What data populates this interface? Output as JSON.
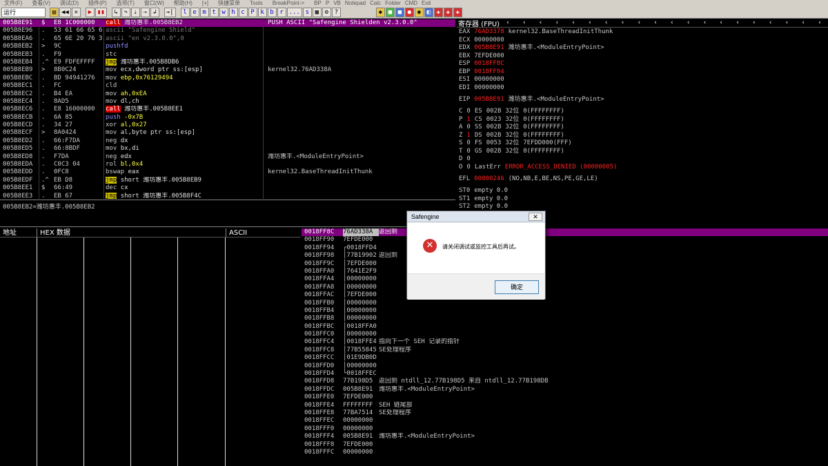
{
  "menu": {
    "items": [
      "文件(F)",
      "查看(V)",
      "调试(D)",
      "插件(P)",
      "选项(T)",
      "窗口(W)",
      "帮助(H)",
      "[+]",
      "快捷菜单",
      "Tools",
      "BreakPoint->"
    ],
    "extra": [
      "BP",
      "P",
      "VB",
      "Notepad",
      "Calc",
      "Folder",
      "CMD",
      "Exit"
    ]
  },
  "toolbar": {
    "status": "运行",
    "letters": [
      "l",
      "e",
      "m",
      "t",
      "w",
      "h",
      "c",
      "P",
      "k",
      "b",
      "r",
      "...",
      "s"
    ]
  },
  "cpu": {
    "rows": [
      {
        "addr": "005B8E91",
        "mark": "$",
        "hex": "E8 1C000000",
        "mn": "call",
        "op": "潍坊惠丰.005B8EB2",
        "cmt": "PUSH ASCII \"Safengine Shielden v2.3.0.0\"",
        "sel": true
      },
      {
        "addr": "005B8E96",
        "mark": ".",
        "hex": "53 61 66 65 6",
        "mn": "ascii",
        "op": "\"Safengine Shield\"",
        "cmt": ""
      },
      {
        "addr": "005B8EA6",
        "mark": ".",
        "hex": "65 6E 20 76 3",
        "mn": "ascii",
        "op": "\"en v2.3.0.0\",0",
        "cmt": ""
      },
      {
        "addr": "005B8EB2",
        "mark": ">",
        "hex": "9C",
        "mn": "pushfd",
        "op": "",
        "cmt": ""
      },
      {
        "addr": "005B8EB3",
        "mark": ".",
        "hex": "F9",
        "mn": "stc",
        "op": "",
        "cmt": ""
      },
      {
        "addr": "005B8EB4",
        "mark": ".^",
        "hex": "E9 FDFEFFFF",
        "mn": "jmp",
        "op": "潍坊惠丰.005B8DB6",
        "cmt": ""
      },
      {
        "addr": "005B8EB9",
        "mark": ">",
        "hex": "8B0C24",
        "mn": "mov",
        "op": "ecx,dword ptr ss:[esp]",
        "cmt": "kernel32.76AD338A"
      },
      {
        "addr": "005B8EBC",
        "mark": ".",
        "hex": "BD 94941276",
        "mn": "mov",
        "op": "ebp,0x76129494",
        "cmt": ""
      },
      {
        "addr": "005B8EC1",
        "mark": ".",
        "hex": "FC",
        "mn": "cld",
        "op": "",
        "cmt": ""
      },
      {
        "addr": "005B8EC2",
        "mark": ".",
        "hex": "B4 EA",
        "mn": "mov",
        "op": "ah,0xEA",
        "cmt": ""
      },
      {
        "addr": "005B8EC4",
        "mark": ".",
        "hex": "8AD5",
        "mn": "mov",
        "op": "dl,ch",
        "cmt": ""
      },
      {
        "addr": "005B8EC6",
        "mark": ".",
        "hex": "E8 16000000",
        "mn": "call",
        "op": "潍坊惠丰.005B8EE1",
        "cmt": ""
      },
      {
        "addr": "005B8ECB",
        "mark": ".",
        "hex": "6A 85",
        "mn": "push",
        "op": "-0x7B",
        "cmt": ""
      },
      {
        "addr": "005B8ECD",
        "mark": ".",
        "hex": "34 27",
        "mn": "xor",
        "op": "al,0x27",
        "cmt": ""
      },
      {
        "addr": "005B8ECF",
        "mark": ">",
        "hex": "8A0424",
        "mn": "mov",
        "op": "al,byte ptr ss:[esp]",
        "cmt": ""
      },
      {
        "addr": "005B8ED2",
        "mark": ".",
        "hex": "66:F7DA",
        "mn": "neg",
        "op": "dx",
        "cmt": ""
      },
      {
        "addr": "005B8ED5",
        "mark": ".",
        "hex": "66:8BDF",
        "mn": "mov",
        "op": "bx,di",
        "cmt": ""
      },
      {
        "addr": "005B8ED8",
        "mark": ".",
        "hex": "F7DA",
        "mn": "neg",
        "op": "edx",
        "cmt": "潍坊惠丰.<ModuleEntryPoint>"
      },
      {
        "addr": "005B8EDA",
        "mark": ".",
        "hex": "C0C3 04",
        "mn": "rol",
        "op": "bl,0x4",
        "cmt": ""
      },
      {
        "addr": "005B8EDD",
        "mark": ".",
        "hex": "0FC8",
        "mn": "bswap",
        "op": "eax",
        "cmt": "kernel32.BaseThreadInitThunk"
      },
      {
        "addr": "005B8EDF",
        "mark": ".^",
        "hex": "EB D8",
        "mn": "jmp",
        "op": "short 潍坊惠丰.005B8EB9",
        "cmt": ""
      },
      {
        "addr": "005B8EE1",
        "mark": "$",
        "hex": "66:49",
        "mn": "dec",
        "op": "cx",
        "cmt": ""
      },
      {
        "addr": "005B8EE3",
        "mark": ".",
        "hex": "EB 67",
        "mn": "jmp",
        "op": "short 潍坊惠丰.005B8F4C",
        "cmt": ""
      }
    ]
  },
  "info": {
    "line": "005B8EB2=潍坊惠丰.005B8EB2"
  },
  "registers": {
    "title": "寄存器 (FPU)",
    "gp": [
      {
        "name": "EAX",
        "val": "76AD3378",
        "note": "kernel32.BaseThreadInitThunk",
        "red": true
      },
      {
        "name": "ECX",
        "val": "00000000",
        "note": "",
        "red": false
      },
      {
        "name": "EDX",
        "val": "005B8E91",
        "note": "潍坊惠丰.<ModuleEntryPoint>",
        "red": true
      },
      {
        "name": "EBX",
        "val": "7EFDE000",
        "note": "",
        "red": false
      },
      {
        "name": "ESP",
        "val": "0018FF8C",
        "note": "",
        "red": true
      },
      {
        "name": "EBP",
        "val": "0018FF94",
        "note": "",
        "red": true
      },
      {
        "name": "ESI",
        "val": "00000000",
        "note": "",
        "red": false
      },
      {
        "name": "EDI",
        "val": "00000000",
        "note": "",
        "red": false
      }
    ],
    "eip": {
      "name": "EIP",
      "val": "005B8E91",
      "note": "潍坊惠丰.<ModuleEntryPoint>"
    },
    "flags": [
      {
        "f": "C",
        "v": "0",
        "red": false,
        "seg": "ES",
        "sv": "002B",
        "bits": "32位",
        "base": "0(FFFFFFFF)"
      },
      {
        "f": "P",
        "v": "1",
        "red": true,
        "seg": "CS",
        "sv": "0023",
        "bits": "32位",
        "base": "0(FFFFFFFF)"
      },
      {
        "f": "A",
        "v": "0",
        "red": false,
        "seg": "SS",
        "sv": "002B",
        "bits": "32位",
        "base": "0(FFFFFFFF)"
      },
      {
        "f": "Z",
        "v": "1",
        "red": true,
        "seg": "DS",
        "sv": "002B",
        "bits": "32位",
        "base": "0(FFFFFFFF)"
      },
      {
        "f": "S",
        "v": "0",
        "red": false,
        "seg": "FS",
        "sv": "0053",
        "bits": "32位",
        "base": "7EFDD000(FFF)"
      },
      {
        "f": "T",
        "v": "0",
        "red": false,
        "seg": "GS",
        "sv": "002B",
        "bits": "32位",
        "base": "0(FFFFFFFF)"
      },
      {
        "f": "D",
        "v": "0",
        "red": false,
        "seg": "",
        "sv": "",
        "bits": "",
        "base": ""
      }
    ],
    "lasterr": {
      "f": "O",
      "v": "0",
      "label": "LastErr",
      "val": "ERROR_ACCESS_DENIED (00000005)"
    },
    "efl": {
      "name": "EFL",
      "val": "00000246",
      "note": "(NO,NB,E,BE,NS,PE,GE,LE)"
    },
    "fpu": [
      {
        "name": "ST0",
        "val": "empty 0.0"
      },
      {
        "name": "ST1",
        "val": "empty 0.0"
      },
      {
        "name": "ST2",
        "val": "empty 0.0"
      }
    ]
  },
  "dump": {
    "col_addr": "地址",
    "col_hex": "HEX 数据",
    "col_ascii": "ASCII"
  },
  "stack": {
    "rows": [
      {
        "addr": "0018FF8C",
        "val": "76AD338A",
        "cmt": "返回到",
        "sel": true
      },
      {
        "addr": "0018FF90",
        "val": "7EFDE000",
        "cmt": ""
      },
      {
        "addr": "0018FF94",
        "val": "┌0018FFD4",
        "cmt": ""
      },
      {
        "addr": "0018FF98",
        "val": "│77B19902",
        "cmt": "返回到"
      },
      {
        "addr": "0018FF9C",
        "val": "│7EFDE000",
        "cmt": ""
      },
      {
        "addr": "0018FFA0",
        "val": "│7641E2F9",
        "cmt": ""
      },
      {
        "addr": "0018FFA4",
        "val": "│00000000",
        "cmt": ""
      },
      {
        "addr": "0018FFA8",
        "val": "│00000000",
        "cmt": ""
      },
      {
        "addr": "0018FFAC",
        "val": "│7EFDE000",
        "cmt": ""
      },
      {
        "addr": "0018FFB0",
        "val": "│00000000",
        "cmt": ""
      },
      {
        "addr": "0018FFB4",
        "val": "│00000000",
        "cmt": ""
      },
      {
        "addr": "0018FFB8",
        "val": "│00000000",
        "cmt": ""
      },
      {
        "addr": "0018FFBC",
        "val": "│0018FFA0",
        "cmt": ""
      },
      {
        "addr": "0018FFC0",
        "val": "│00000000",
        "cmt": ""
      },
      {
        "addr": "0018FFC4",
        "val": "│0018FFE4",
        "cmt": "指向下一个 SEH 记录的指针"
      },
      {
        "addr": "0018FFC8",
        "val": "│77B55845",
        "cmt": "SE处理程序"
      },
      {
        "addr": "0018FFCC",
        "val": "│01E9DB0D",
        "cmt": ""
      },
      {
        "addr": "0018FFD0",
        "val": "│00000000",
        "cmt": ""
      },
      {
        "addr": "0018FFD4",
        "val": "└0018FFEC",
        "cmt": ""
      },
      {
        "addr": "0018FFD8",
        "val": "77B198D5",
        "cmt": "返回到 ntdll_12.77B198D5 来自 ntdll_12.77B198DB"
      },
      {
        "addr": "0018FFDC",
        "val": "005B8E91",
        "cmt": "潍坊惠丰.<ModuleEntryPoint>"
      },
      {
        "addr": "0018FFE0",
        "val": "7EFDE000",
        "cmt": ""
      },
      {
        "addr": "0018FFE4",
        "val": "FFFFFFFF",
        "cmt": "SEH 链尾部"
      },
      {
        "addr": "0018FFE8",
        "val": "77BA7514",
        "cmt": "SE处理程序"
      },
      {
        "addr": "0018FFEC",
        "val": "00000000",
        "cmt": ""
      },
      {
        "addr": "0018FFF0",
        "val": "00000000",
        "cmt": ""
      },
      {
        "addr": "0018FFF4",
        "val": "005B8E91",
        "cmt": "潍坊惠丰.<ModuleEntryPoint>"
      },
      {
        "addr": "0018FFF8",
        "val": "7EFDE000",
        "cmt": ""
      },
      {
        "addr": "0018FFFC",
        "val": "00000000",
        "cmt": ""
      }
    ]
  },
  "dialog": {
    "title": "Safengine",
    "close": "✕",
    "message": "请关闭调试或监控工具后再试。",
    "ok": "确定",
    "icon": "✕"
  },
  "colors": {
    "selection": "#800080",
    "error_red": "#d32f2f",
    "jmp_yellow": "#d0c000",
    "call_red": "#d00000"
  }
}
